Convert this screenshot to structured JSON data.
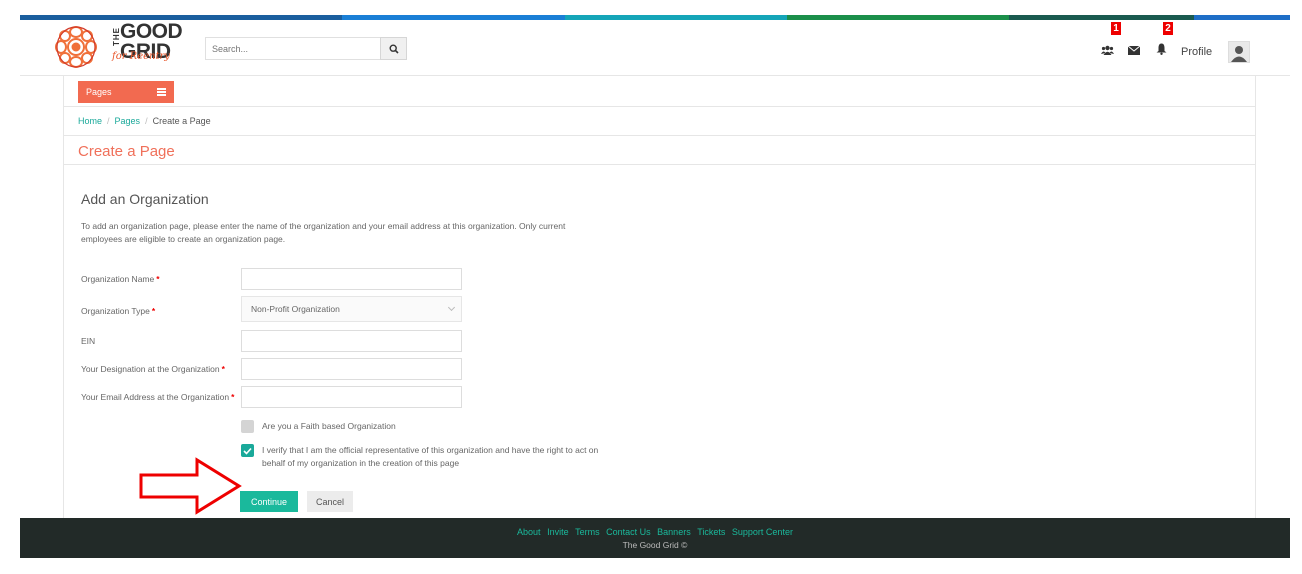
{
  "colors": {
    "topbar_stripes": [
      "#1a5e9e",
      "#1a7fd6",
      "#14a5b8",
      "#1b8f4a",
      "#1a5a4f",
      "#1e6ec7"
    ],
    "accent": "#f26a50",
    "teal": "#1ab99c",
    "footer_bg": "#222a28",
    "badge": "#ee0000"
  },
  "header": {
    "logo": {
      "the": "THE",
      "good": "GOOD",
      "grid": "GRID",
      "tagline": "for Reentry"
    },
    "search": {
      "placeholder": "Search...",
      "icon": "search-icon"
    },
    "icons": {
      "groups": "users-icon",
      "messages": "envelope-icon",
      "notifications": "bell-icon"
    },
    "badges": {
      "groups": "1",
      "notifications": "2"
    },
    "profile_label": "Profile"
  },
  "toolbar": {
    "pages_label": "Pages"
  },
  "breadcrumb": {
    "home": "Home",
    "pages": "Pages",
    "current": "Create a Page",
    "separator": "/"
  },
  "page": {
    "title": "Create a Page",
    "section_title": "Add an Organization",
    "intro": "To add an organization page, please enter the name of the organization and your email address at this organization. Only current employees are eligible to create an organization page."
  },
  "form": {
    "org_name_label": "Organization Name",
    "org_type_label": "Organization Type",
    "org_type_value": "Non-Profit Organization",
    "ein_label": "EIN",
    "designation_label": "Your Designation at the Organization",
    "email_label": "Your Email Address at the Organization",
    "required_mark": "*",
    "faith_label": "Are you a Faith based Organization",
    "faith_checked": false,
    "verify_label": "I verify that I am the official representative of this organization and have the right to act on behalf of my organization in the creation of this page",
    "verify_checked": true,
    "continue_label": "Continue",
    "cancel_label": "Cancel"
  },
  "footer": {
    "links": [
      "About",
      "Invite",
      "Terms",
      "Contact Us",
      "Banners",
      "Tickets",
      "Support Center"
    ],
    "copyright": "The Good Grid ©"
  }
}
